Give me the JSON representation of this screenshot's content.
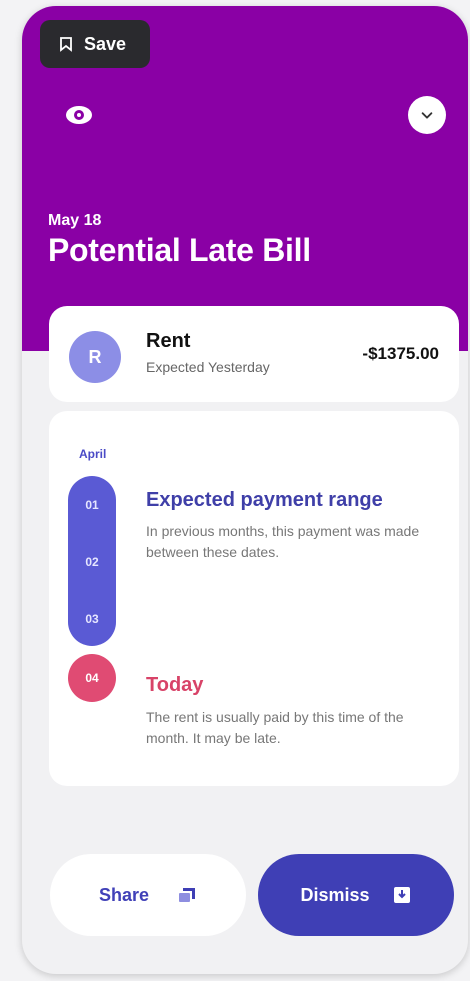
{
  "colors": {
    "hero_bg": "#8a00a5",
    "accent": "#3f3fb5",
    "range_pill": "#5a5ad4",
    "today": "#e04b73",
    "avatar_bg": "#8c8ee6"
  },
  "toolbar": {
    "save_label": "Save",
    "save_icon": "bookmark-icon"
  },
  "header": {
    "visibility_icon": "eye-icon",
    "collapse_icon": "chevron-down-icon",
    "date": "May 18",
    "title": "Potential Late Bill"
  },
  "bill": {
    "avatar_letter": "R",
    "name": "Rent",
    "status": "Expected Yesterday",
    "amount": "-$1375.00"
  },
  "timeline": {
    "month": "April",
    "range_days": [
      "01",
      "02",
      "03"
    ],
    "today_day": "04",
    "range_title": "Expected payment range",
    "range_desc": "In previous months, this payment was made between these dates.",
    "today_title": "Today",
    "today_desc": "The rent is usually paid by this time of the month. It may be late."
  },
  "actions": {
    "share_label": "Share",
    "share_icon": "share-icon",
    "dismiss_label": "Dismiss",
    "dismiss_icon": "archive-icon"
  }
}
